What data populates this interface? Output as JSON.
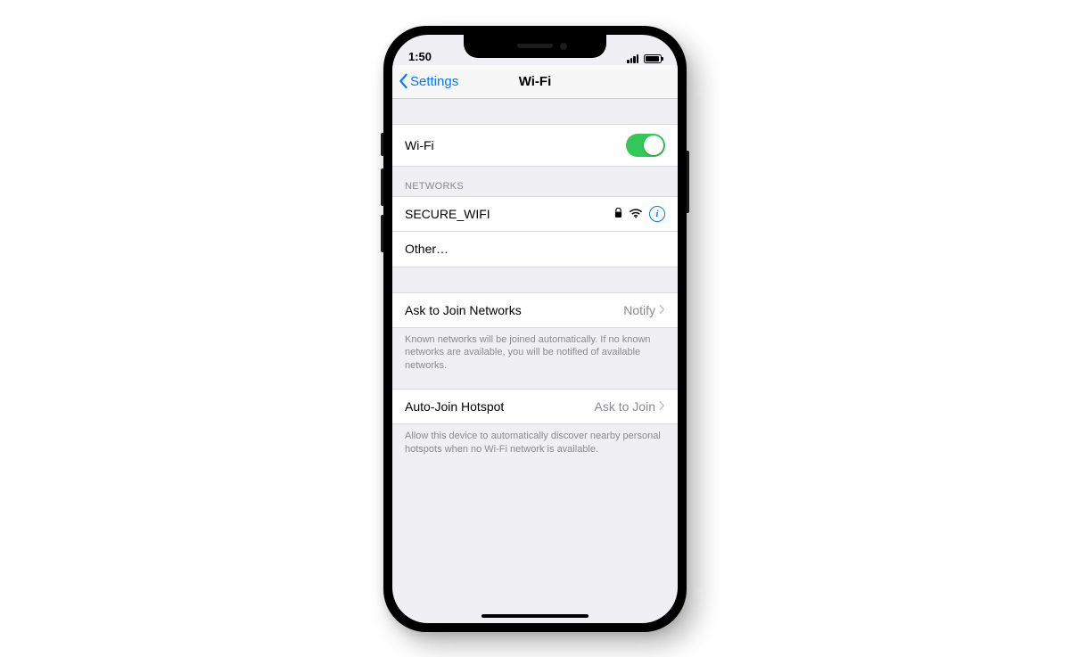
{
  "status": {
    "time": "1:50"
  },
  "nav": {
    "back_label": "Settings",
    "title": "Wi-Fi"
  },
  "wifi": {
    "label": "Wi-Fi",
    "enabled": true
  },
  "networks": {
    "header": "NETWORKS",
    "items": [
      {
        "name": "SECURE_WIFI",
        "locked": true
      }
    ],
    "other_label": "Other…"
  },
  "ask_join": {
    "label": "Ask to Join Networks",
    "value": "Notify",
    "footer": "Known networks will be joined automatically. If no known networks are available, you will be notified of available networks."
  },
  "auto_hotspot": {
    "label": "Auto-Join Hotspot",
    "value": "Ask to Join",
    "footer": "Allow this device to automatically discover nearby personal hotspots when no Wi-Fi network is available."
  }
}
